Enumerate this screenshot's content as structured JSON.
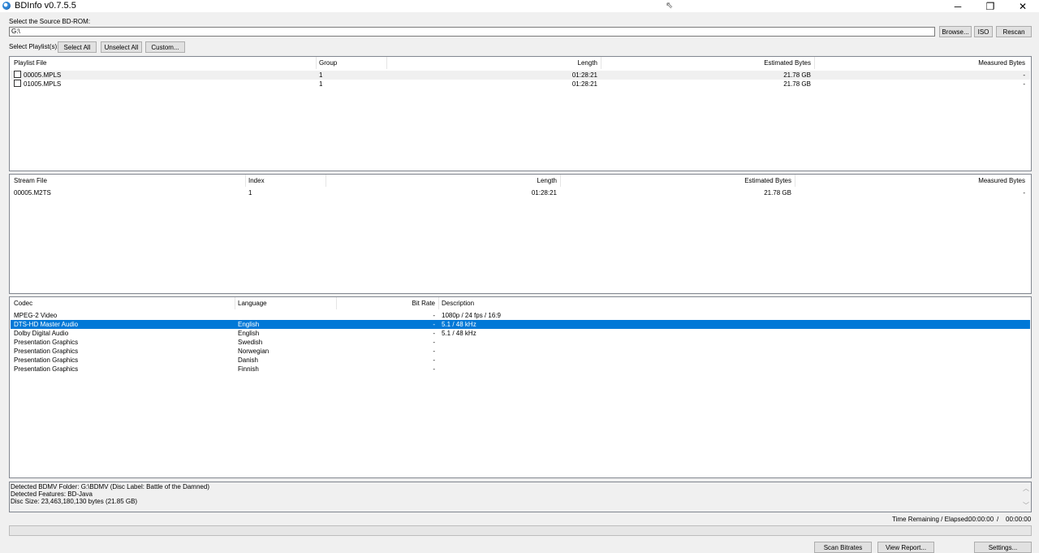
{
  "window": {
    "title": "BDInfo v0.7.5.5",
    "minimize_icon": "─",
    "restore_icon": "❐",
    "close_icon": "✕"
  },
  "source": {
    "label": "Select the Source BD-ROM:",
    "path": "G:\\",
    "browse_label": "Browse...",
    "iso_label": "ISO",
    "rescan_label": "Rescan"
  },
  "playlist_select": {
    "label": "Select Playlist(s):",
    "select_all": "Select All",
    "unselect_all": "Unselect All",
    "custom": "Custom..."
  },
  "playlists": {
    "columns": [
      "Playlist File",
      "Group",
      "Length",
      "Estimated Bytes",
      "Measured Bytes"
    ],
    "rows": [
      {
        "file": "00005.MPLS",
        "group": "1",
        "length": "01:28:21",
        "est": "21.78 GB",
        "meas": "-"
      },
      {
        "file": "01005.MPLS",
        "group": "1",
        "length": "01:28:21",
        "est": "21.78 GB",
        "meas": "-"
      }
    ]
  },
  "streams": {
    "columns": [
      "Stream File",
      "Index",
      "Length",
      "Estimated Bytes",
      "Measured Bytes"
    ],
    "rows": [
      {
        "file": "00005.M2TS",
        "index": "1",
        "length": "01:28:21",
        "est": "21.78 GB",
        "meas": "-"
      }
    ]
  },
  "codecs": {
    "columns": [
      "Codec",
      "Language",
      "Bit Rate",
      "Description"
    ],
    "rows": [
      {
        "codec": "MPEG-2 Video",
        "lang": "",
        "bitrate": "-",
        "desc": "1080p / 24 fps / 16:9"
      },
      {
        "codec": "DTS-HD Master Audio",
        "lang": "English",
        "bitrate": "-",
        "desc": "5.1 / 48 kHz"
      },
      {
        "codec": "Dolby Digital Audio",
        "lang": "English",
        "bitrate": "-",
        "desc": "5.1 / 48 kHz"
      },
      {
        "codec": "Presentation Graphics",
        "lang": "Swedish",
        "bitrate": "-",
        "desc": ""
      },
      {
        "codec": "Presentation Graphics",
        "lang": "Norwegian",
        "bitrate": "-",
        "desc": ""
      },
      {
        "codec": "Presentation Graphics",
        "lang": "Danish",
        "bitrate": "-",
        "desc": ""
      },
      {
        "codec": "Presentation Graphics",
        "lang": "Finnish",
        "bitrate": "-",
        "desc": ""
      }
    ],
    "selected_index": 1
  },
  "status": {
    "lines": [
      "Detected BDMV Folder: G:\\BDMV (Disc Label: Battle of the Damned)",
      "Detected Features: BD-Java",
      "Disc Size: 23,463,180,130 bytes (21.85 GB)"
    ]
  },
  "timer": {
    "label": "Time Remaining / Elapsed:",
    "remaining": "00:00:00",
    "separator": "/",
    "elapsed": "00:00:00"
  },
  "progress": 0,
  "footer": {
    "scan_bitrates": "Scan Bitrates",
    "view_report": "View Report...",
    "settings": "Settings..."
  }
}
